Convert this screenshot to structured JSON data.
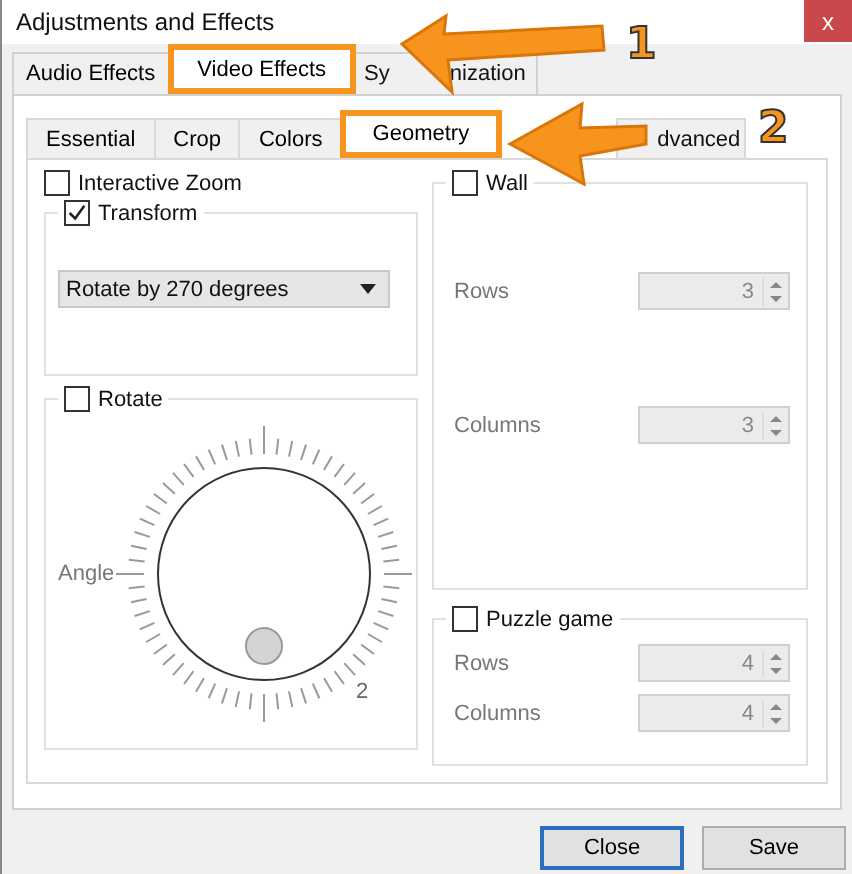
{
  "window": {
    "title": "Adjustments and Effects",
    "close": "x"
  },
  "tabs": [
    {
      "label_parts": [
        "Audio Effects"
      ],
      "selected": false,
      "highlighted": false
    },
    {
      "label_parts": [
        "Video Effects"
      ],
      "selected": true,
      "highlighted": true
    },
    {
      "label_parts": [
        "Sy",
        "nization"
      ],
      "selected": false,
      "highlighted": false
    }
  ],
  "subtabs": [
    {
      "label": "Essential",
      "selected": false,
      "highlighted": false
    },
    {
      "label": "Crop",
      "selected": false,
      "highlighted": false
    },
    {
      "label": "Colors",
      "selected": false,
      "highlighted": false
    },
    {
      "label": "Geometry",
      "selected": true,
      "highlighted": true
    },
    {
      "label": "dvanced",
      "selected": false,
      "highlighted": false
    }
  ],
  "interactive_zoom": {
    "label": "Interactive Zoom",
    "checked": false
  },
  "transform": {
    "label": "Transform",
    "checked": true,
    "dropdown": "Rotate by 270 degrees"
  },
  "rotate": {
    "label": "Rotate",
    "checked": false,
    "angle_label": "Angle",
    "dial_mark": "2"
  },
  "wall": {
    "label": "Wall",
    "checked": false,
    "fields": [
      {
        "label": "Rows",
        "value": "3"
      },
      {
        "label": "Columns",
        "value": "3"
      }
    ]
  },
  "puzzle": {
    "label": "Puzzle game",
    "checked": false,
    "fields": [
      {
        "label": "Rows",
        "value": "4"
      },
      {
        "label": "Columns",
        "value": "4"
      }
    ]
  },
  "buttons": [
    {
      "label": "Close",
      "selected": true
    },
    {
      "label": "Save",
      "selected": false
    }
  ],
  "annotations": [
    {
      "number": "1"
    },
    {
      "number": "2"
    }
  ]
}
